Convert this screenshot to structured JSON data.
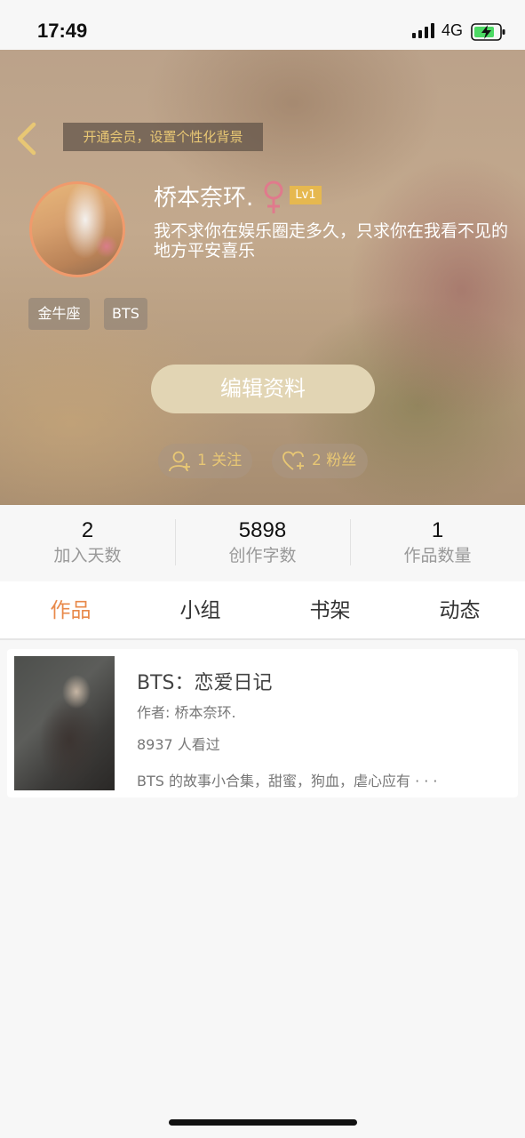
{
  "status_bar": {
    "time": "17:49",
    "network": "4G",
    "icons": [
      "signal-icon",
      "battery-charging-icon"
    ]
  },
  "header": {
    "vip_prompt": "开通会员，设置个性化背景",
    "username": "桥本奈环.",
    "gender_icon": "female-icon",
    "level": "Lv1",
    "signature": "我不求你在娱乐圈走多久，只求你在我看不见的地方平安喜乐",
    "tags": [
      "金牛座",
      "BTS"
    ],
    "edit_button": "编辑资料",
    "follow": "1 关注",
    "fans": "2 粉丝",
    "colors": {
      "accent_gold": "#e8c774",
      "avatar_ring": "#f09a6c",
      "level_badge": "#e6b84f",
      "female_icon": "#e07a8c"
    }
  },
  "stats": [
    {
      "value": "2",
      "label": "加入天数"
    },
    {
      "value": "5898",
      "label": "创作字数"
    },
    {
      "value": "1",
      "label": "作品数量"
    }
  ],
  "tabs": [
    {
      "label": "作品",
      "active": true
    },
    {
      "label": "小组",
      "active": false
    },
    {
      "label": "书架",
      "active": false
    },
    {
      "label": "动态",
      "active": false
    }
  ],
  "works": [
    {
      "title": "BTS：恋爱日记",
      "author": "作者: 桥本奈环.",
      "views": "8937 人看过",
      "description": "BTS 的故事小合集，甜蜜，狗血，虐心应有 · · ·"
    }
  ],
  "theme": {
    "active_tab_color": "#e8894a"
  }
}
